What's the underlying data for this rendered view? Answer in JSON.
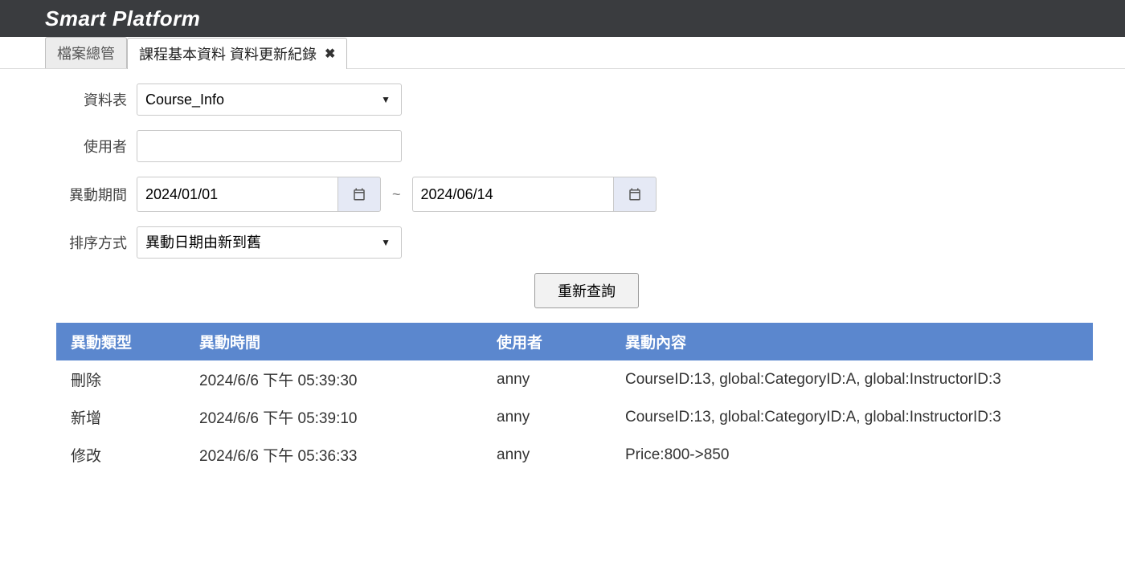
{
  "header": {
    "title": "Smart Platform"
  },
  "tabs": [
    {
      "label": "檔案總管",
      "active": false,
      "closable": false
    },
    {
      "label": "課程基本資料 資料更新紀錄",
      "active": true,
      "closable": true
    }
  ],
  "form": {
    "table_label": "資料表",
    "table_value": "Course_Info",
    "user_label": "使用者",
    "user_value": "",
    "period_label": "異動期間",
    "date_from": "2024/01/01",
    "date_to": "2024/06/14",
    "date_separator": "~",
    "sort_label": "排序方式",
    "sort_value": "異動日期由新到舊",
    "search_btn": "重新查詢"
  },
  "table": {
    "headers": [
      "異動類型",
      "異動時間",
      "使用者",
      "異動內容"
    ],
    "rows": [
      {
        "type": "刪除",
        "time": "2024/6/6 下午 05:39:30",
        "user": "anny",
        "content": "CourseID:13, global:CategoryID:A, global:InstructorID:3"
      },
      {
        "type": "新增",
        "time": "2024/6/6 下午 05:39:10",
        "user": "anny",
        "content": "CourseID:13, global:CategoryID:A, global:InstructorID:3"
      },
      {
        "type": "修改",
        "time": "2024/6/6 下午 05:36:33",
        "user": "anny",
        "content": "Price:800->850"
      }
    ]
  }
}
